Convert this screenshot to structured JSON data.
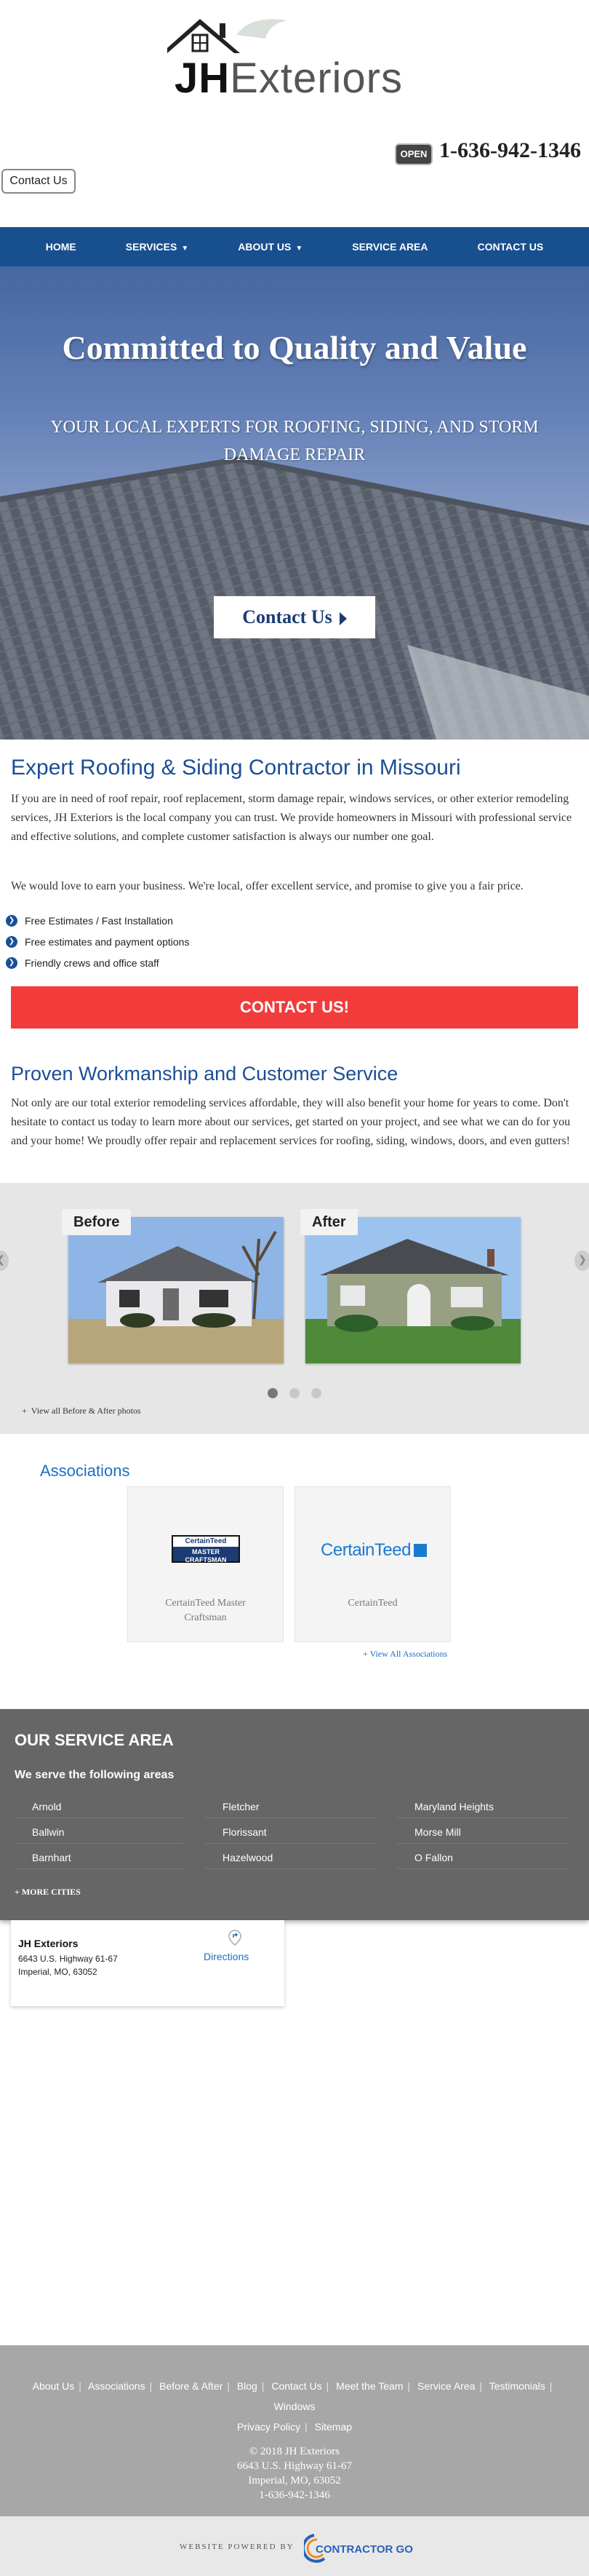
{
  "header": {
    "logo_jh": "JH",
    "logo_rest": "Exteriors",
    "open_badge": "OPEN",
    "phone": "1-636-942-1346",
    "contact_button": "Contact Us"
  },
  "nav": {
    "items": [
      {
        "label": "HOME",
        "dropdown": false
      },
      {
        "label": "SERVICES",
        "dropdown": true
      },
      {
        "label": "ABOUT US",
        "dropdown": true
      },
      {
        "label": "SERVICE AREA",
        "dropdown": false
      },
      {
        "label": "CONTACT US",
        "dropdown": false
      }
    ]
  },
  "hero": {
    "title": "Committed to Quality and Value",
    "subtitle": "YOUR LOCAL EXPERTS FOR ROOFING, SIDING, AND STORM DAMAGE REPAIR",
    "button": "Contact Us"
  },
  "intro": {
    "heading": "Expert Roofing & Siding Contractor in Missouri",
    "paragraph1": "If you are in need of roof repair, roof replacement, storm damage repair, windows services, or other exterior remodeling services, JH Exteriors is the local company you can trust. We provide homeowners in Missouri with professional service and effective solutions, and complete customer satisfaction is always our number one goal.",
    "paragraph2": "We would love to earn your business. We're local, offer excellent service, and promise to give you a fair price.",
    "bullets": [
      "Free Estimates / Fast Installation",
      "Free estimates and payment options",
      "Friendly crews and office staff"
    ],
    "cta": "CONTACT US!"
  },
  "workmanship": {
    "heading": "Proven Workmanship and Customer Service",
    "paragraph": "Not only are our total exterior remodeling services affordable, they will also benefit your home for years to come. Don't hesitate to contact us today to learn more about our services, get started on your project, and see what we can do for you and your home! We proudly offer repair and replacement services for roofing, siding, windows, doors, and even gutters!"
  },
  "before_after": {
    "before_label": "Before",
    "after_label": "After",
    "view_all": "View all Before & After photos",
    "active_dot": 1,
    "dot_count": 3
  },
  "associations": {
    "heading": "Associations",
    "items": [
      {
        "name": "CertainTeed Master Craftsman",
        "logo_top": "CertainTeed",
        "logo_bottom": "MASTER CRAFTSMAN"
      },
      {
        "name": "CertainTeed",
        "logo_top": "CertainTeed"
      }
    ],
    "view_all": "View All Associations"
  },
  "service_area": {
    "heading": "OUR SERVICE AREA",
    "subheading": "We serve the following areas",
    "cities": [
      [
        "Arnold",
        "Ballwin",
        "Barnhart"
      ],
      [
        "Fletcher",
        "Florissant",
        "Hazelwood"
      ],
      [
        "Maryland Heights",
        "Morse Mill",
        "O Fallon"
      ]
    ],
    "more": "+ MORE CITIES"
  },
  "address": {
    "name": "JH Exteriors",
    "line1": "6643 U.S. Highway 61-67",
    "line2": "Imperial, MO, 63052",
    "directions": "Directions"
  },
  "footer": {
    "links": [
      "About Us",
      "Associations",
      "Before & After",
      "Blog",
      "Contact Us",
      "Meet the Team",
      "Service Area",
      "Testimonials",
      "Windows",
      "Privacy Policy",
      "Sitemap"
    ],
    "copyright": "© 2018 JH Exteriors",
    "address1": "6643 U.S. Highway 61-67",
    "address2": "Imperial, MO, 63052",
    "phone": "1-636-942-1346",
    "powered_by": "WEBSITE POWERED BY",
    "powered_logo": "CONTRACTOR GO"
  },
  "colors": {
    "nav": "#184f8f",
    "heading_blue": "#1b4f96",
    "cta_red": "#f23b3b",
    "service_bg": "#666666",
    "footer_bg": "#a7a7a7"
  }
}
